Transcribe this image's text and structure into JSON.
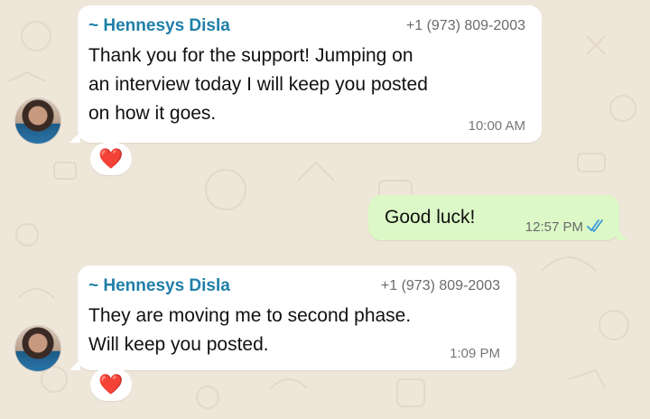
{
  "messages": [
    {
      "sender": "~ Hennesys Disla",
      "phone": "+1 (973) 809-2003",
      "lines": [
        "Thank you for the support! Jumping on",
        "an interview today I will keep you posted",
        "on how it goes."
      ],
      "time": "10:00 AM",
      "reaction": "❤️"
    },
    {
      "text": "Good luck!",
      "time": "12:57 PM",
      "status": "read"
    },
    {
      "sender": "~ Hennesys Disla",
      "phone": "+1 (973) 809-2003",
      "lines": [
        "They are moving me to second phase.",
        "Will keep you posted."
      ],
      "time": "1:09 PM",
      "reaction": "❤️"
    }
  ],
  "colors": {
    "background": "#efe6da",
    "incoming_bubble": "#ffffff",
    "outgoing_bubble": "#dcf8c6",
    "sender_name": "#1f7fa8",
    "read_ticks": "#3a9ad9",
    "reaction": "#e0252d"
  }
}
